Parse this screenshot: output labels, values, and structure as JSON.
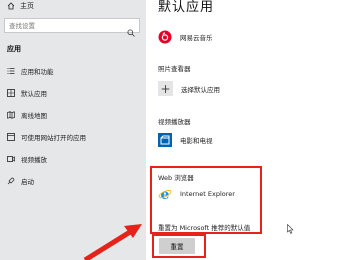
{
  "home": {
    "label": "主页",
    "icon": "home-icon"
  },
  "search": {
    "placeholder": "查找设置",
    "icon": "search-icon"
  },
  "sidebar": {
    "section": "应用",
    "items": [
      {
        "label": "应用和功能",
        "icon": "apps-list-icon"
      },
      {
        "label": "默认应用",
        "icon": "default-apps-icon"
      },
      {
        "label": "离线地图",
        "icon": "offline-map-icon"
      },
      {
        "label": "可使用网站打开的应用",
        "icon": "web-apps-icon"
      },
      {
        "label": "视频播放",
        "icon": "video-playback-icon"
      },
      {
        "label": "启动",
        "icon": "startup-icon"
      }
    ]
  },
  "main": {
    "title": "默认应用",
    "music_app": {
      "label": "网易云音乐",
      "icon": "netease-music-icon",
      "color": "#e60026"
    },
    "photo": {
      "category": "照片查看器",
      "app_label": "选择默认应用",
      "icon": "plus-icon"
    },
    "video": {
      "category": "视频播放器",
      "app_label": "电影和电视",
      "icon": "film-icon",
      "color": "#0063b1"
    },
    "web": {
      "category": "Web 浏览器",
      "app_label": "Internet Explorer",
      "icon": "internet-explorer-icon",
      "color": "#1e8fd6"
    },
    "reset_note": "重置为 Microsoft 推荐的默认值",
    "reset_button": "重置"
  },
  "highlight_color": "#e5231b"
}
